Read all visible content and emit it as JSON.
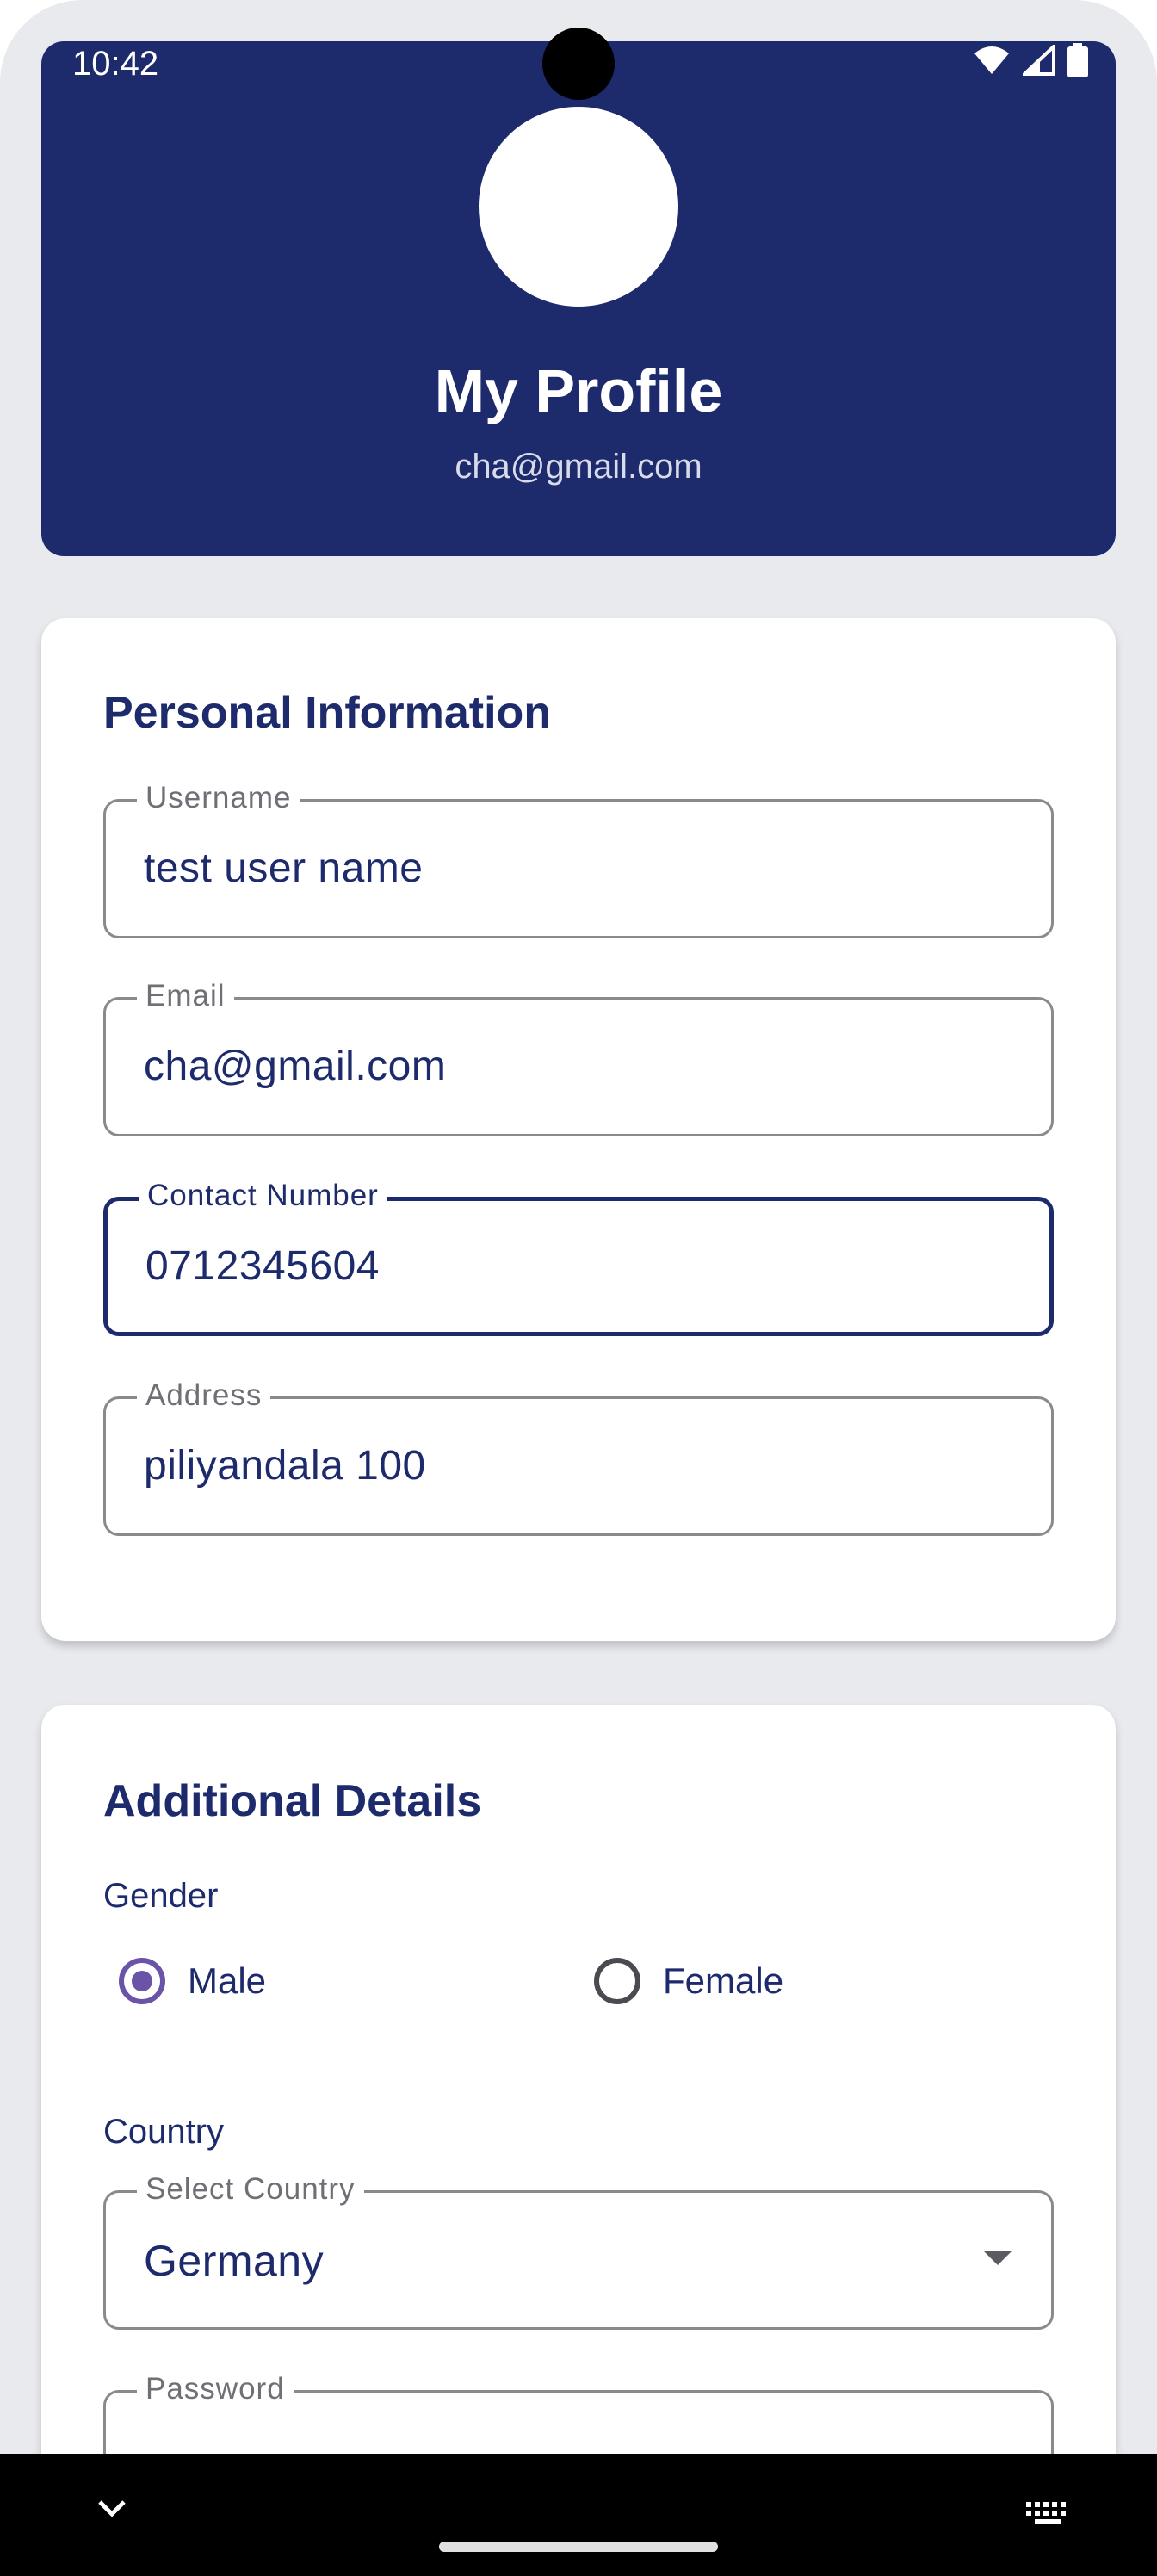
{
  "status_bar": {
    "time": "10:42",
    "icons": [
      "wifi-icon",
      "signal-icon",
      "battery-icon"
    ]
  },
  "header": {
    "title": "My Profile",
    "email": "cha@gmail.com",
    "background_color": "#1d2a6c"
  },
  "personal_info": {
    "title": "Personal Information",
    "fields": [
      {
        "label": "Username",
        "value": "test user name"
      },
      {
        "label": "Email",
        "value": "cha@gmail.com"
      },
      {
        "label": "Contact Number",
        "value": "0712345604",
        "focused": true
      },
      {
        "label": "Address",
        "value": "piliyandala 100"
      }
    ]
  },
  "additional": {
    "title": "Additional Details",
    "gender_label": "Gender",
    "gender_options": [
      {
        "label": "Male",
        "selected": true
      },
      {
        "label": "Female",
        "selected": false
      }
    ],
    "country_label": "Country",
    "country_field_label": "Select Country",
    "country_value": "Germany",
    "password_label": "Password"
  },
  "nav_bar": {
    "icons": [
      "chevron-down-icon",
      "keyboard-icon"
    ]
  },
  "colors": {
    "primary": "#1d2a6c",
    "radio_accent": "#6b54a8",
    "background": "#e9eaee"
  }
}
